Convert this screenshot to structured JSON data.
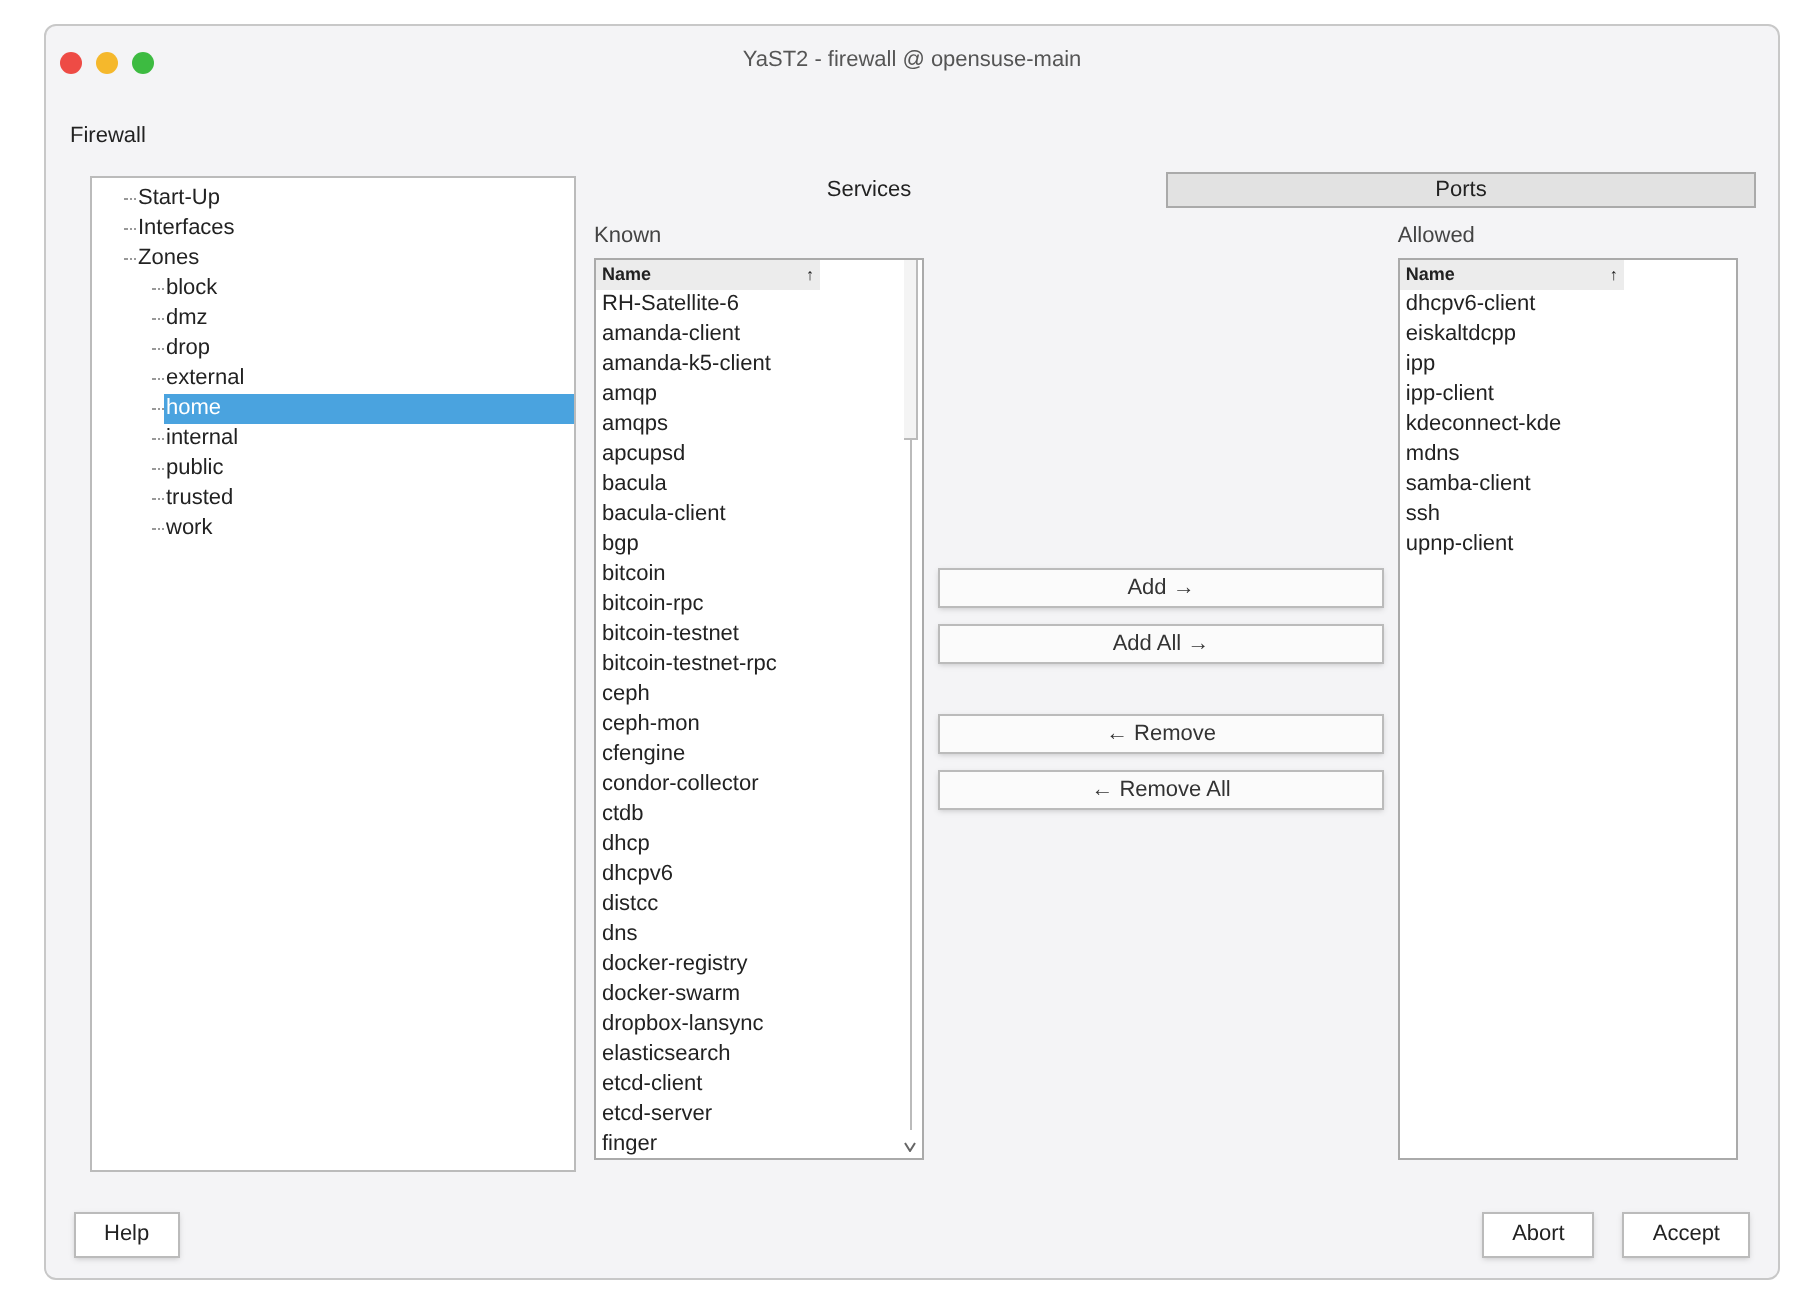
{
  "window": {
    "title": "YaST2 - firewall @ opensuse-main"
  },
  "heading": "Firewall",
  "tree": [
    {
      "label": "Start-Up",
      "selected": false
    },
    {
      "label": "Interfaces",
      "selected": false
    },
    {
      "label": "Zones",
      "selected": false,
      "children": [
        {
          "label": "block",
          "selected": false
        },
        {
          "label": "dmz",
          "selected": false
        },
        {
          "label": "drop",
          "selected": false
        },
        {
          "label": "external",
          "selected": false
        },
        {
          "label": "home",
          "selected": true
        },
        {
          "label": "internal",
          "selected": false
        },
        {
          "label": "public",
          "selected": false
        },
        {
          "label": "trusted",
          "selected": false
        },
        {
          "label": "work",
          "selected": false
        }
      ]
    }
  ],
  "tabs": [
    {
      "label": "Services",
      "selected": true
    },
    {
      "label": "Ports",
      "selected": false
    }
  ],
  "known": {
    "label": "Known",
    "column": "Name",
    "sort_indicator": "↑",
    "rows": [
      "RH-Satellite-6",
      "amanda-client",
      "amanda-k5-client",
      "amqp",
      "amqps",
      "apcupsd",
      "bacula",
      "bacula-client",
      "bgp",
      "bitcoin",
      "bitcoin-rpc",
      "bitcoin-testnet",
      "bitcoin-testnet-rpc",
      "ceph",
      "ceph-mon",
      "cfengine",
      "condor-collector",
      "ctdb",
      "dhcp",
      "dhcpv6",
      "distcc",
      "dns",
      "docker-registry",
      "docker-swarm",
      "dropbox-lansync",
      "elasticsearch",
      "etcd-client",
      "etcd-server",
      "finger"
    ]
  },
  "transfer_buttons": [
    {
      "label": "Add →"
    },
    {
      "label": "Add All →"
    },
    {
      "label": "← Remove"
    },
    {
      "label": "← Remove All"
    }
  ],
  "allowed": {
    "label": "Allowed",
    "column": "Name",
    "sort_indicator": "↑",
    "rows": [
      "dhcpv6-client",
      "eiskaltdcpp",
      "ipp",
      "ipp-client",
      "kdeconnect-kde",
      "mdns",
      "samba-client",
      "ssh",
      "upnp-client"
    ]
  },
  "buttons": {
    "left": [
      "Help"
    ],
    "right": [
      "Abort",
      "Accept"
    ]
  }
}
